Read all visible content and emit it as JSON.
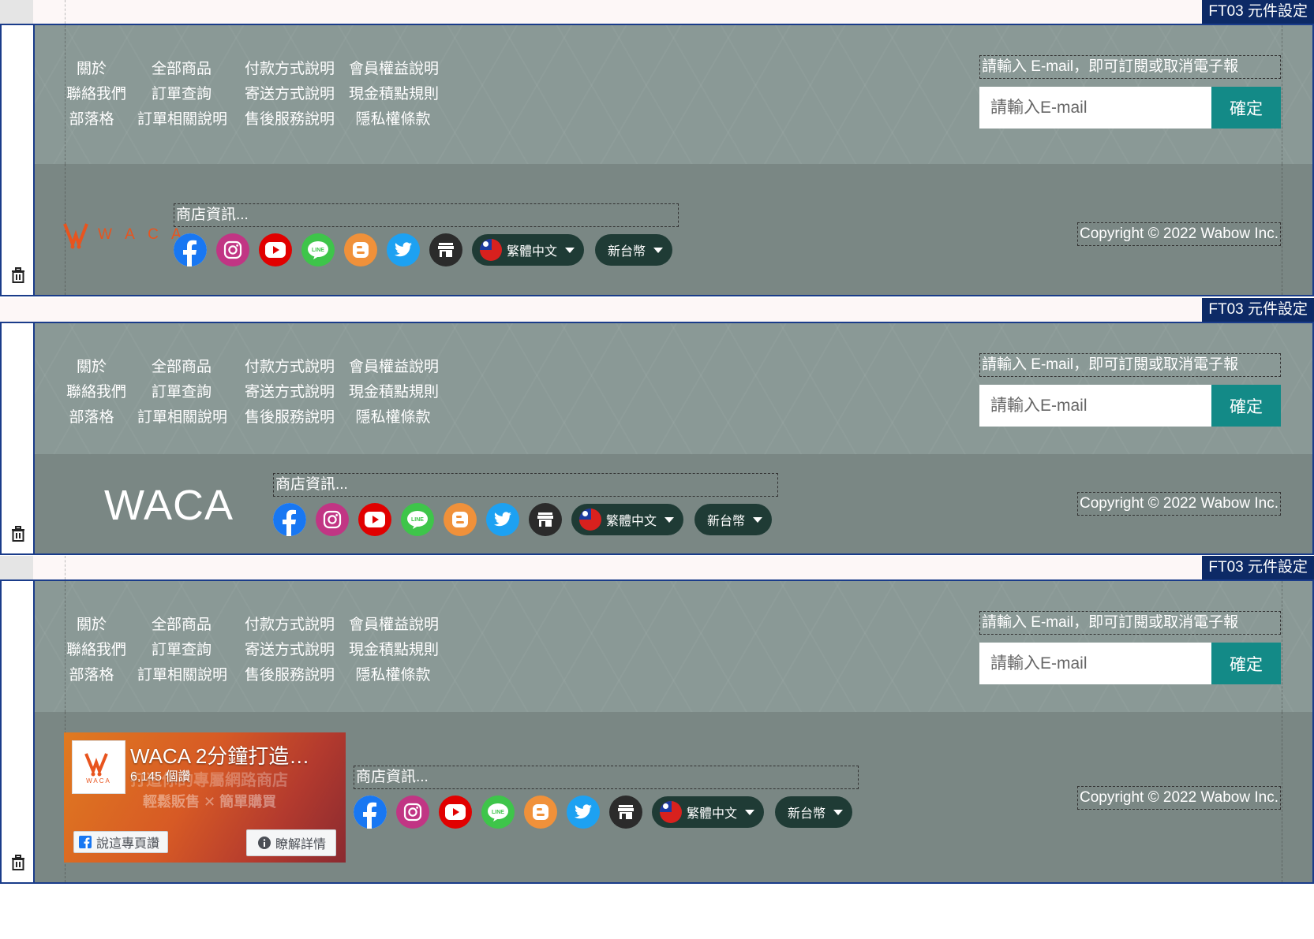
{
  "component_tag": "FT03 元件設定",
  "link_columns": [
    [
      "關於",
      "聯絡我們",
      "部落格"
    ],
    [
      "全部商品",
      "訂單查詢",
      "訂單相關說明"
    ],
    [
      "付款方式說明",
      "寄送方式說明",
      "售後服務說明"
    ],
    [
      "會員權益說明",
      "現金積點規則",
      "隱私權條款"
    ]
  ],
  "newsletter": {
    "label": "請輸入 E-mail，即可訂閱或取消電子報",
    "placeholder": "請輸入E-mail",
    "button": "確定"
  },
  "store_info": "商店資訊...",
  "language": "繁體中文",
  "currency": "新台幣",
  "copyright": "Copyright © 2022 Wabow Inc.",
  "text_logo": "WACA",
  "image_logo_letters": "W A C A",
  "social_icons": [
    "facebook-icon",
    "instagram-icon",
    "youtube-icon",
    "line-icon",
    "blogger-icon",
    "twitter-icon",
    "shop-icon"
  ],
  "fb_widget": {
    "title": "WACA 2分鐘打造…",
    "likes": "6,145 個讚",
    "bg_line1": "打造你的專屬網路商店",
    "bg_line2": "輕鬆販售 ✕ 簡單購買",
    "like_button": "說這專頁讚",
    "learn_button": "瞭解詳情",
    "thumb_text": "WACA"
  },
  "colors": {
    "tag_bg": "#0d2a66",
    "footer_upper": "#8a9996",
    "footer_lower": "#7a8784",
    "accent": "#138a87",
    "pill_bg": "#1f3b35"
  }
}
